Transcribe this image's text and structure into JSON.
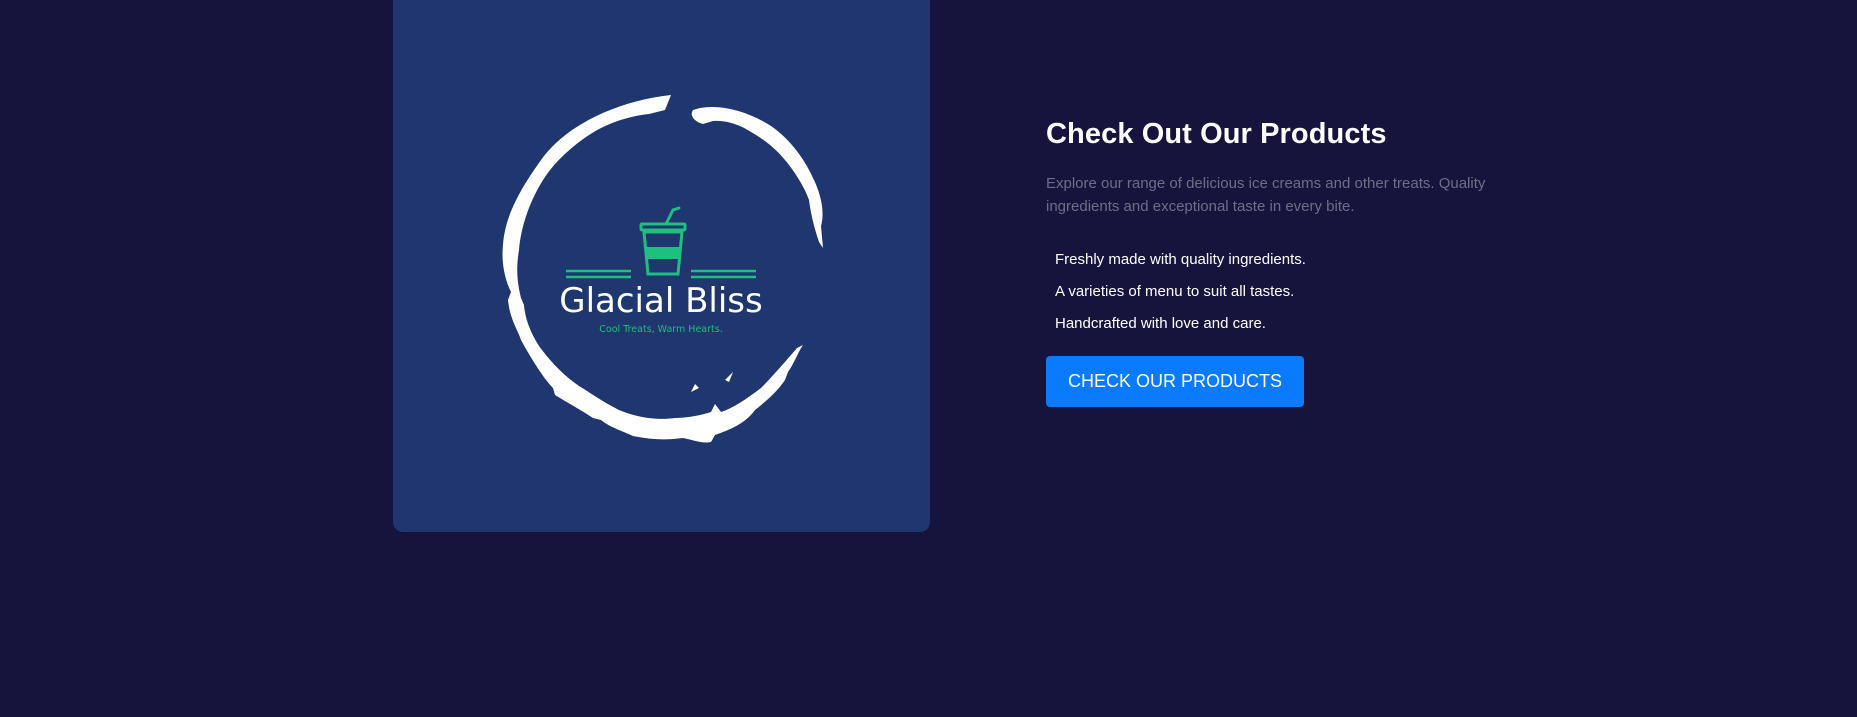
{
  "logo": {
    "brand_name": "Glacial Bliss",
    "tagline": "Cool Treats, Warm Hearts."
  },
  "products_section": {
    "heading": "Check Out Our Products",
    "description": "Explore our range of delicious ice creams and other treats. Quality ingredients and exceptional taste in every bite.",
    "features": [
      "Freshly made with quality ingredients.",
      "A varieties of menu to suit all tastes.",
      "Handcrafted with love and care."
    ],
    "cta_label": "CHECK OUR PRODUCTS"
  },
  "colors": {
    "page_background": "#16143d",
    "card_background": "#1f366f",
    "accent_green": "#1fbf7f",
    "button_blue": "#0a7bff",
    "muted_text": "#6f6d87"
  }
}
